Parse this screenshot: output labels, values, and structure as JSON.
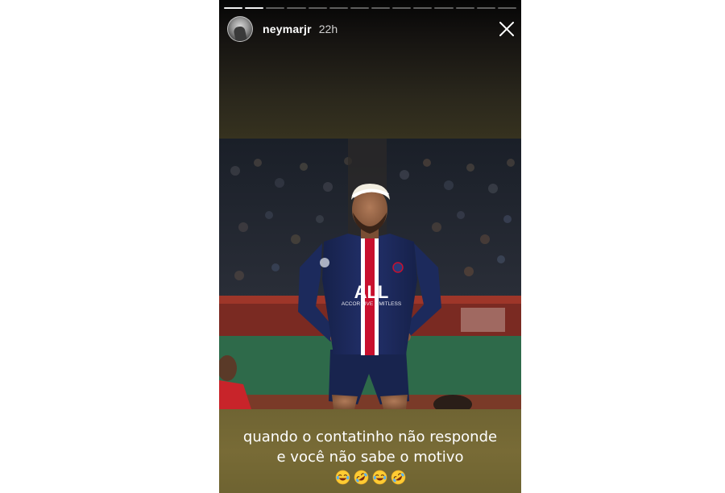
{
  "story": {
    "username": "neymarjr",
    "timestamp": "22h",
    "progress": {
      "total_segments": 14,
      "completed_segments": 2
    },
    "caption": {
      "line1": "quando o contatinho não responde",
      "line2": "e você não sabe o motivo"
    },
    "emojis": [
      "face-with-tears-of-joy-icon",
      "rolling-on-floor-laughing-icon",
      "face-with-tears-of-joy-icon",
      "rolling-on-floor-laughing-icon"
    ],
    "photo": {
      "jersey_text": "ALL",
      "sponsor_text": "ACCOR LIVE LIMITLESS"
    }
  },
  "colors": {
    "top_band": "#141210",
    "bottom_band": "#786b36",
    "jersey_navy": "#1c2a58",
    "jersey_red": "#c8102e",
    "pitch_green": "#2e6a4a"
  }
}
